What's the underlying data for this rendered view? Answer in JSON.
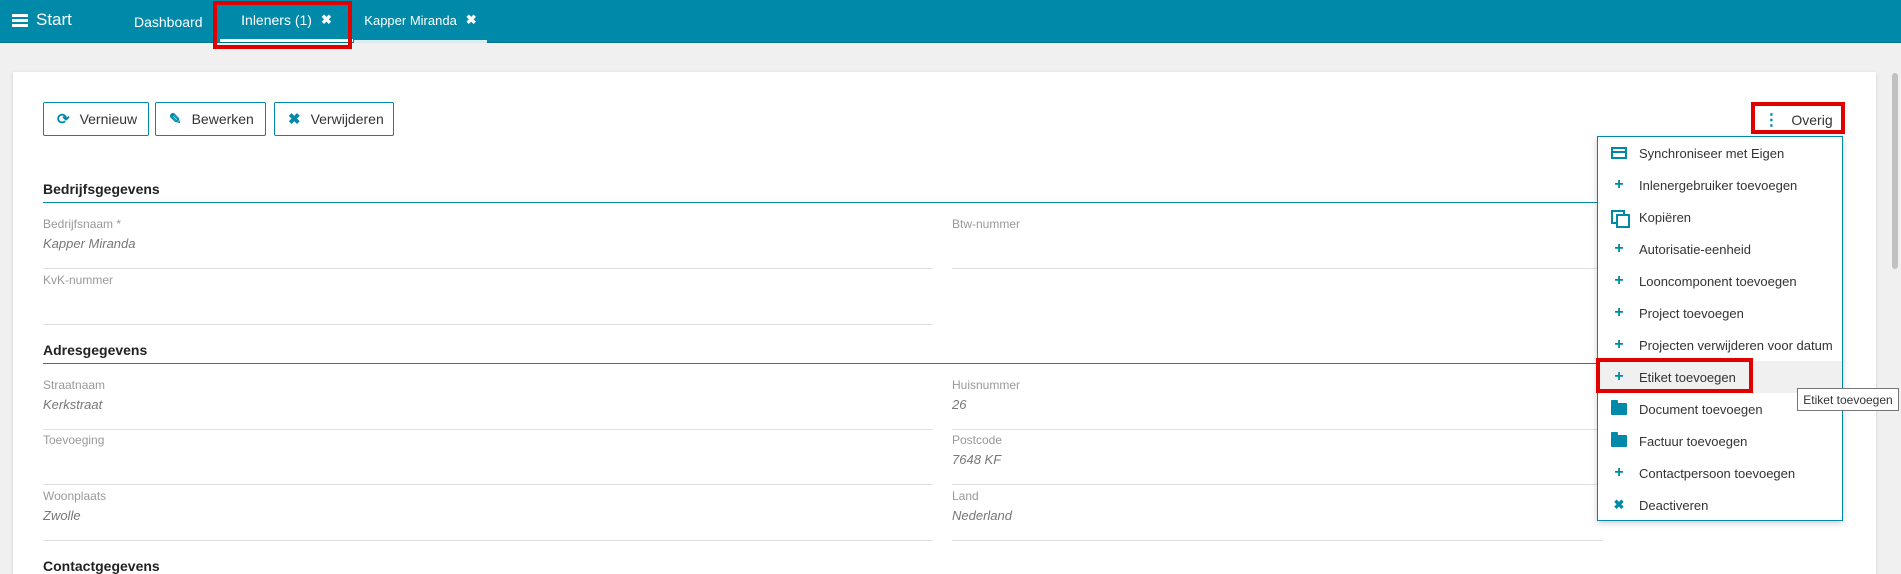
{
  "header": {
    "start_label": "Start",
    "tabs": [
      {
        "label": "Dashboard"
      },
      {
        "label": "Inleners (1)",
        "close": "✖"
      },
      {
        "label": "Kapper Miranda",
        "close": "✖"
      }
    ]
  },
  "toolbar": {
    "refresh_label": "Vernieuw",
    "edit_label": "Bewerken",
    "delete_label": "Verwijderen",
    "more_label": "Overig"
  },
  "sections": {
    "company": {
      "title": "Bedrijfsgegevens",
      "fields": [
        {
          "label": "Bedrijfsnaam  *",
          "value": "Kapper Miranda"
        },
        {
          "label": "Btw-nummer",
          "value": ""
        },
        {
          "label": "KvK-nummer",
          "value": ""
        }
      ]
    },
    "address": {
      "title": "Adresgegevens",
      "fields": [
        {
          "label": "Straatnaam",
          "value": "Kerkstraat"
        },
        {
          "label": "Huisnummer",
          "value": "26"
        },
        {
          "label": "Toevoeging",
          "value": ""
        },
        {
          "label": "Postcode",
          "value": "7648 KF"
        },
        {
          "label": "Woonplaats",
          "value": "Zwolle"
        },
        {
          "label": "Land",
          "value": "Nederland"
        }
      ]
    },
    "contact": {
      "title": "Contactgegevens"
    }
  },
  "menu": {
    "items": [
      {
        "label": "Synchroniseer met Eigen",
        "icon": "sync-icon"
      },
      {
        "label": "Inlenergebruiker toevoegen",
        "icon": "plus-icon"
      },
      {
        "label": "Kopiëren",
        "icon": "copy-icon"
      },
      {
        "label": "Autorisatie-eenheid",
        "icon": "plus-icon"
      },
      {
        "label": "Looncomponent toevoegen",
        "icon": "plus-icon"
      },
      {
        "label": "Project toevoegen",
        "icon": "plus-icon"
      },
      {
        "label": "Projecten verwijderen voor datum",
        "icon": "plus-icon"
      },
      {
        "label": "Etiket toevoegen",
        "icon": "plus-icon"
      },
      {
        "label": "Document toevoegen",
        "icon": "folder-icon"
      },
      {
        "label": "Factuur toevoegen",
        "icon": "folder-icon"
      },
      {
        "label": "Contactpersoon toevoegen",
        "icon": "plus-icon"
      },
      {
        "label": "Deactiveren",
        "icon": "close-icon"
      }
    ]
  },
  "tooltip": {
    "text": "Etiket toevoegen"
  },
  "colors": {
    "accent": "#0089a8",
    "highlight": "#e00000"
  }
}
